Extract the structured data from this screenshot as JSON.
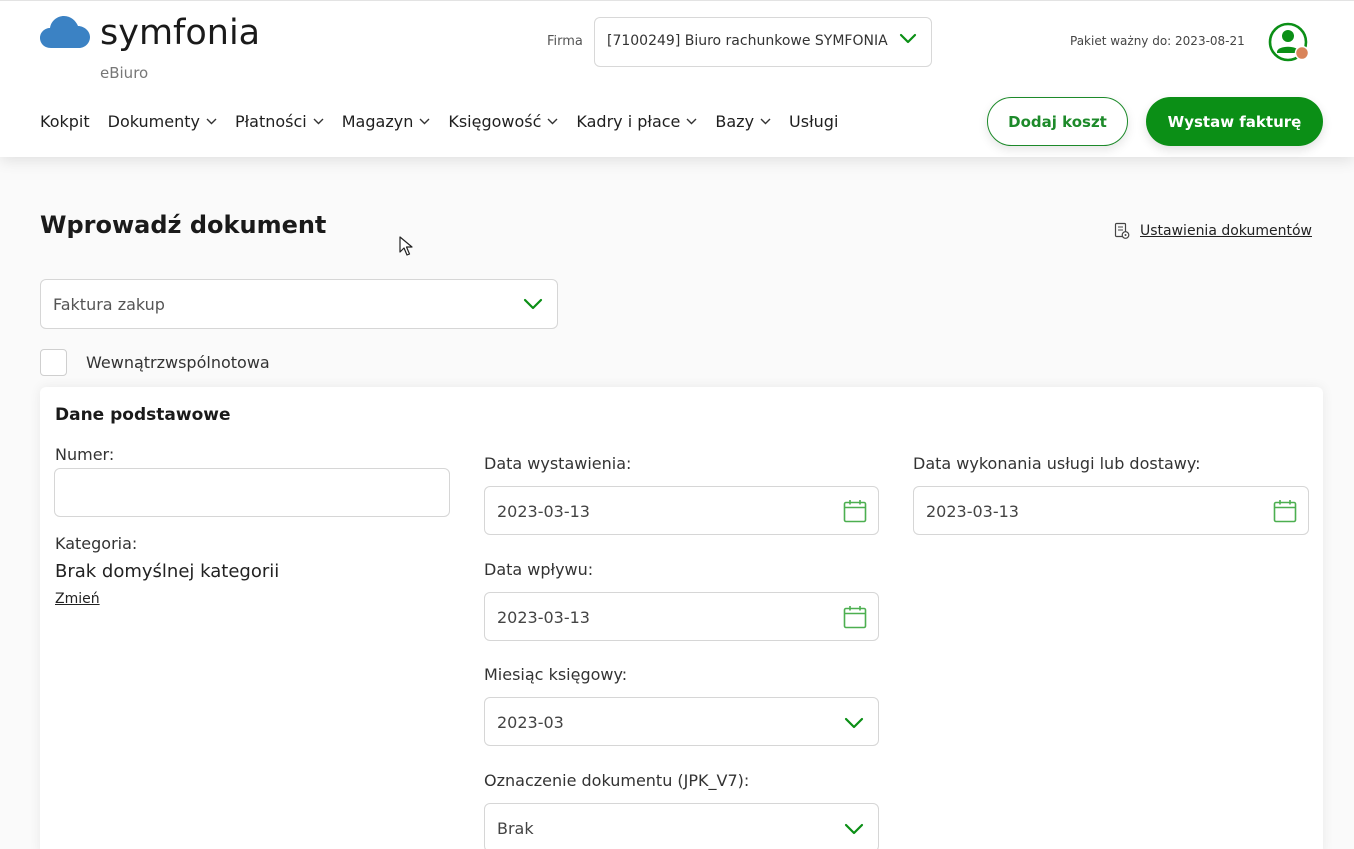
{
  "brand": {
    "logo_text": "symfonia",
    "product": "eBiuro",
    "accent": "#0b8f16",
    "logo_color": "#3b82c4"
  },
  "header": {
    "firma_label": "Firma",
    "firma_value": "[7100249] Biuro rachunkowe SYMFONIA",
    "package_text": "Pakiet ważny do: 2023-08-21",
    "avatar_icon": "user-icon"
  },
  "nav": {
    "items": [
      {
        "label": "Kokpit",
        "dropdown": false
      },
      {
        "label": "Dokumenty",
        "dropdown": true
      },
      {
        "label": "Płatności",
        "dropdown": true
      },
      {
        "label": "Magazyn",
        "dropdown": true
      },
      {
        "label": "Księgowość",
        "dropdown": true
      },
      {
        "label": "Kadry i płace",
        "dropdown": true
      },
      {
        "label": "Bazy",
        "dropdown": true
      },
      {
        "label": "Usługi",
        "dropdown": false
      }
    ]
  },
  "actions": {
    "add_cost": "Dodaj koszt",
    "issue_invoice": "Wystaw fakturę"
  },
  "page": {
    "title": "Wprowadź dokument",
    "settings_link": "Ustawienia dokumentów",
    "document_type": "Faktura zakup",
    "intra_community_label": "Wewnątrzwspólnotowa",
    "intra_community_checked": false
  },
  "form": {
    "section_title": "Dane podstawowe",
    "numer_label": "Numer:",
    "numer_value": "",
    "kategoria_label": "Kategoria:",
    "kategoria_value": "Brak domyślnej kategorii",
    "change_link": "Zmień",
    "issue_date_label": "Data wystawienia:",
    "issue_date": "2023-03-13",
    "receipt_date_label": "Data wpływu:",
    "receipt_date": "2023-03-13",
    "accounting_month_label": "Miesiąc księgowy:",
    "accounting_month": "2023-03",
    "jpk_label": "Oznaczenie dokumentu (JPK_V7):",
    "jpk_value": "Brak",
    "delivery_date_label": "Data wykonania usługi lub dostawy:",
    "delivery_date": "2023-03-13"
  }
}
